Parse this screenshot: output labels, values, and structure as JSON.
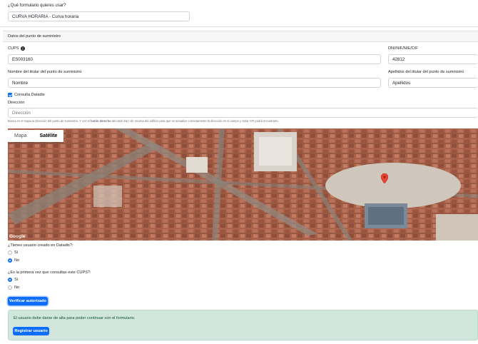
{
  "form_select": {
    "label": "¿Qué formulario quieres usar?",
    "value": "CURVA HORARIA - Curva horaria"
  },
  "section": {
    "title": "Datos del punto de suministro"
  },
  "cups": {
    "label": "CUPS",
    "info_icon": "info-circle-icon",
    "value": "ES003160"
  },
  "dni": {
    "label": "DNI/NIF/NIE/CIF",
    "value": "42812"
  },
  "titular_nombre": {
    "label": "Nombre del titular del punto de suministro",
    "value": "Nombre"
  },
  "titular_apellidos": {
    "label": "Apellidos del titular del punto de suministro",
    "value": "Apellidos"
  },
  "consulta_datadis": {
    "label": "Consulta Datadis",
    "checked": true
  },
  "direccion": {
    "label": "Dirección",
    "placeholder": "Dirección",
    "help_prefix": "Busca en el mapa la dirección del punto de suministro. Y con el ",
    "help_bold": "botón derecho",
    "help_suffix": " del ratón haz clic encima del edificio para que se actualice correctamente la dirección en el campo y Solar API podrá encontrarlo."
  },
  "map": {
    "tab_map": "Mapa",
    "tab_satellite": "Satélite",
    "active_tab": "Satélite",
    "attribution": "Google",
    "marker_icon": "map-pin-icon"
  },
  "q_usuario": {
    "label": "¿Tienes usuario creado en Datadis?:",
    "options": [
      "Sí",
      "No"
    ],
    "selected": "No"
  },
  "q_primera": {
    "label": "¿Es la primera vez que consultas este CUPS?:",
    "options": [
      "Sí",
      "No"
    ],
    "selected": "Sí"
  },
  "buttons": {
    "verificar": "Verificar autorizado",
    "registrar": "Registrar usuario"
  },
  "alert": {
    "message": "El usuario debe darse de alta para poder continuar con el formulario."
  },
  "colors": {
    "primary": "#0d6efd",
    "alert_bg": "#d1e7dd",
    "alert_border": "#badbcc"
  }
}
